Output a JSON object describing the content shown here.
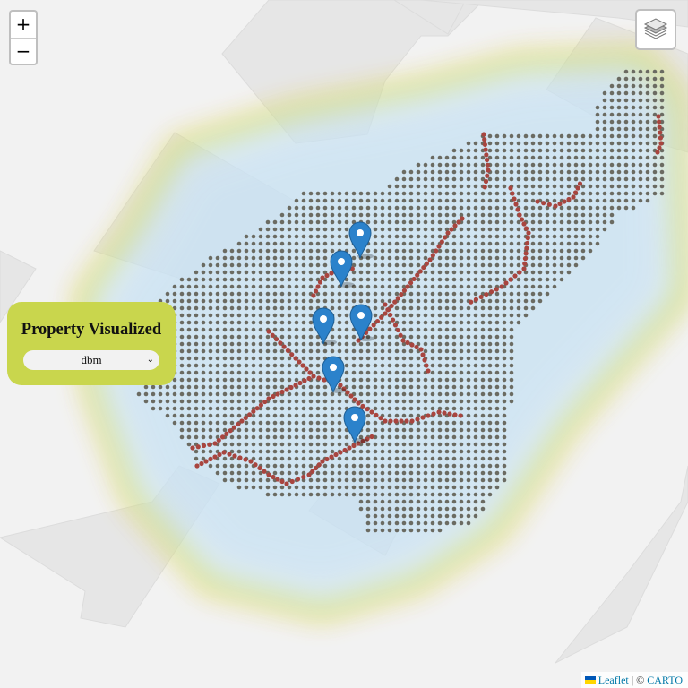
{
  "zoom": {
    "in_label": "+",
    "out_label": "−"
  },
  "layers_control": {
    "icon": "layers-icon"
  },
  "property_panel": {
    "title": "Property Visualized",
    "selected_option": "dbm"
  },
  "attribution": {
    "leaflet_label": "Leaflet",
    "separator": "| ©",
    "carto_label": "CARTO",
    "flag_icon": "ukraine-flag-icon"
  },
  "markers": {
    "count": 6,
    "color": "#2b82cb",
    "icon": "map-marker-icon"
  },
  "colors": {
    "survey_point": "#6b6b62",
    "path_point": "#a8453f",
    "heat_halo": "#c9e2f3",
    "panel_bg": "#c9d64d",
    "link": "#0078a8"
  }
}
